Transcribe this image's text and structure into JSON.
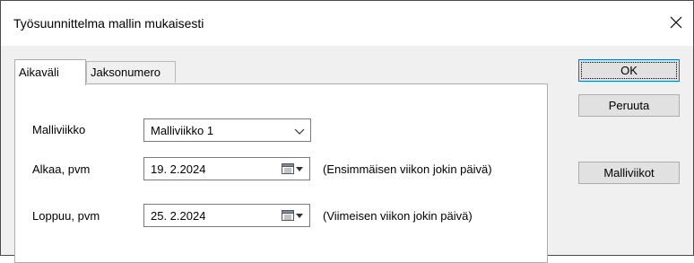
{
  "window": {
    "title": "Työsuunnittelma mallin mukaisesti",
    "close_icon": "close-icon"
  },
  "tabs": [
    {
      "label": "Aikaväli",
      "active": true
    },
    {
      "label": "Jaksonumero",
      "active": false
    }
  ],
  "form": {
    "template_week": {
      "label": "Malliviikko",
      "value": "Malliviikko 1"
    },
    "start_date": {
      "label": "Alkaa, pvm",
      "value": "19.  2.2024",
      "hint": "(Ensimmäisen viikon jokin päivä)"
    },
    "end_date": {
      "label": "Loppuu, pvm",
      "value": "25.  2.2024",
      "hint": "(Viimeisen viikon jokin päivä)"
    }
  },
  "buttons": {
    "ok": "OK",
    "cancel": "Peruuta",
    "template_weeks": "Malliviikot"
  },
  "colors": {
    "dialog_bg": "#f0f0f0",
    "panel_bg": "#ffffff",
    "button_bg": "#e1e1e1",
    "default_button_border": "#0078d7"
  }
}
